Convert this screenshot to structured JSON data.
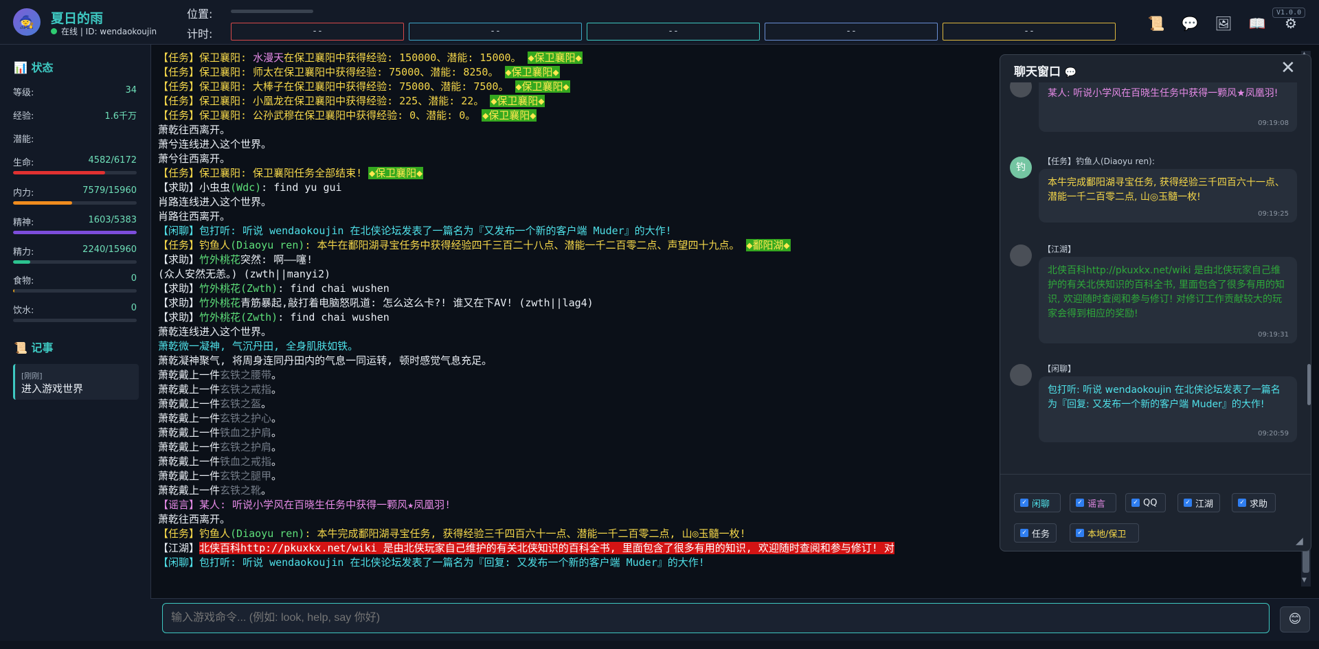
{
  "header": {
    "avatar_glyph": "🧙",
    "username": "夏日的雨",
    "status": "在线 | ID: wendaokoujin",
    "position_label": "位置:",
    "timer_label": "计时:",
    "timers": [
      "--",
      "--",
      "--",
      "--",
      "--"
    ],
    "timer_colors": [
      "#d94a4a",
      "#3ea7c9",
      "#3ec9c2",
      "#6a8fd6",
      "#e0b93e"
    ],
    "version": "V1.0.0",
    "icons": [
      {
        "name": "scroll-icon",
        "glyph": "📜"
      },
      {
        "name": "chat-bubble-icon",
        "glyph": "💬"
      },
      {
        "name": "image-icon",
        "glyph": "🖼"
      },
      {
        "name": "book-icon",
        "glyph": "📖"
      },
      {
        "name": "gear-icon",
        "glyph": "⚙"
      }
    ]
  },
  "sidebar": {
    "status_title": "状态",
    "stats": [
      {
        "label": "等级:",
        "value": "34"
      },
      {
        "label": "经验:",
        "value": "1.6千万"
      },
      {
        "label": "潜能:",
        "value": ""
      },
      {
        "label": "生命:",
        "value": "4582/6172",
        "ratio": 0.742,
        "color": "#e03131"
      },
      {
        "label": "内力:",
        "value": "7579/15960",
        "ratio": 0.475,
        "color": "#f08c1e"
      },
      {
        "label": "精神:",
        "value": "1603/5383",
        "ratio": 1.0,
        "color": "#7c4ddb"
      },
      {
        "label": "精力:",
        "value": "2240/15960",
        "ratio": 0.14,
        "color": "#2cc28f"
      },
      {
        "label": "食物:",
        "value": "0",
        "ratio": 0.01,
        "color": "#d1961e"
      },
      {
        "label": "饮水:",
        "value": "0",
        "ratio": 0,
        "color": "#2f7ef0"
      }
    ],
    "notes_title": "记事",
    "note": {
      "time": "[刚刚]",
      "text": "进入游戏世界"
    }
  },
  "log": [
    [
      {
        "t": "【任务】保卫襄阳: ",
        "c": "y"
      },
      {
        "t": "水漫天",
        "c": "p"
      },
      {
        "t": "在保卫襄阳中获得经验: 150000、潜能: 15000。 ",
        "c": "y"
      },
      {
        "t": "◆保卫襄阳◆",
        "c": "tag"
      }
    ],
    [
      {
        "t": "【任务】保卫襄阳: 师太在保卫襄阳中获得经验: 75000、潜能: 8250。 ",
        "c": "y"
      },
      {
        "t": "◆保卫襄阳◆",
        "c": "tag"
      }
    ],
    [
      {
        "t": "【任务】保卫襄阳: 大棒子在保卫襄阳中获得经验: 75000、潜能: 7500。 ",
        "c": "y"
      },
      {
        "t": "◆保卫襄阳◆",
        "c": "tag"
      }
    ],
    [
      {
        "t": "【任务】保卫襄阳: 小凰龙在保卫襄阳中获得经验: 225、潜能: 22。 ",
        "c": "y"
      },
      {
        "t": "◆保卫襄阳◆",
        "c": "tag"
      }
    ],
    [
      {
        "t": "【任务】保卫襄阳: 公孙武穆在保卫襄阳中获得经验: 0、潜能: 0。 ",
        "c": "y"
      },
      {
        "t": "◆保卫襄阳◆",
        "c": "tag"
      }
    ],
    [
      {
        "t": "萧乾往西离开。",
        "c": "w"
      }
    ],
    [
      {
        "t": "萧兮连线进入这个世界。",
        "c": "w"
      }
    ],
    [
      {
        "t": "萧兮往西离开。",
        "c": "w"
      }
    ],
    [
      {
        "t": "【任务】保卫襄阳: 保卫襄阳任务全部结束! ",
        "c": "y"
      },
      {
        "t": "◆保卫襄阳◆",
        "c": "tag"
      }
    ],
    [
      {
        "t": "【求助】小虫虫",
        "c": "w"
      },
      {
        "t": "(Wdc)",
        "c": "g"
      },
      {
        "t": ": find yu gui",
        "c": "w"
      }
    ],
    [
      {
        "t": "肖路连线进入这个世界。",
        "c": "w"
      }
    ],
    [
      {
        "t": "肖路往西离开。",
        "c": "w"
      }
    ],
    [
      {
        "t": "【闲聊】包打听: 听说 wendaokoujin 在北侠论坛发表了一篇名为『又发布一个新的客户端 Muder』的大作!",
        "c": "c"
      }
    ],
    [
      {
        "t": "【任务】钓鱼人",
        "c": "y"
      },
      {
        "t": "(Diaoyu ren)",
        "c": "g"
      },
      {
        "t": ": 本牛在鄱阳湖寻宝任务中获得经验四千三百二十八点、潜能一千二百零二点、声望四十九点。 ",
        "c": "y"
      },
      {
        "t": "◆鄱阳湖◆",
        "c": "tag"
      }
    ],
    [
      {
        "t": "【求助】",
        "c": "w"
      },
      {
        "t": "竹外桃花",
        "c": "g"
      },
      {
        "t": "突然: 啊——噻!",
        "c": "w"
      }
    ],
    [
      {
        "t": "(众人安然无恙。) (zwth||manyi2)",
        "c": "w"
      }
    ],
    [
      {
        "t": "【求助】",
        "c": "w"
      },
      {
        "t": "竹外桃花(Zwth)",
        "c": "g"
      },
      {
        "t": ": find chai wushen",
        "c": "w"
      }
    ],
    [
      {
        "t": "【求助】",
        "c": "w"
      },
      {
        "t": "竹外桃花",
        "c": "g"
      },
      {
        "t": "青筋暴起,敲打着电脑怒吼道: 怎么这么卡?! 谁又在下AV! (zwth||lag4)",
        "c": "w"
      }
    ],
    [
      {
        "t": "【求助】",
        "c": "w"
      },
      {
        "t": "竹外桃花(Zwth)",
        "c": "g"
      },
      {
        "t": ": find chai wushen",
        "c": "w"
      }
    ],
    [
      {
        "t": "萧乾连线进入这个世界。",
        "c": "w"
      }
    ],
    [
      {
        "t": "萧乾微一凝神, 气沉丹田, 全身肌肤如铁。",
        "c": "c"
      }
    ],
    [
      {
        "t": "萧乾凝神聚气, 将周身连同丹田内的气息一同运转, 顿时感觉气息充足。",
        "c": "w"
      }
    ],
    [
      {
        "t": "萧乾戴上一件",
        "c": "w"
      },
      {
        "t": "玄铁之腰带",
        "c": "gray"
      },
      {
        "t": "。",
        "c": "w"
      }
    ],
    [
      {
        "t": "萧乾戴上一件",
        "c": "w"
      },
      {
        "t": "玄铁之戒指",
        "c": "gray"
      },
      {
        "t": "。",
        "c": "w"
      }
    ],
    [
      {
        "t": "萧乾戴上一件",
        "c": "w"
      },
      {
        "t": "玄铁之盔",
        "c": "gray"
      },
      {
        "t": "。",
        "c": "w"
      }
    ],
    [
      {
        "t": "萧乾戴上一件",
        "c": "w"
      },
      {
        "t": "玄铁之护心",
        "c": "gray"
      },
      {
        "t": "。",
        "c": "w"
      }
    ],
    [
      {
        "t": "萧乾戴上一件",
        "c": "w"
      },
      {
        "t": "铁血之护肩",
        "c": "gray"
      },
      {
        "t": "。",
        "c": "w"
      }
    ],
    [
      {
        "t": "萧乾戴上一件",
        "c": "w"
      },
      {
        "t": "玄铁之护肩",
        "c": "gray"
      },
      {
        "t": "。",
        "c": "w"
      }
    ],
    [
      {
        "t": "萧乾戴上一件",
        "c": "w"
      },
      {
        "t": "铁血之戒指",
        "c": "gray"
      },
      {
        "t": "。",
        "c": "w"
      }
    ],
    [
      {
        "t": "萧乾戴上一件",
        "c": "w"
      },
      {
        "t": "玄铁之腿甲",
        "c": "gray"
      },
      {
        "t": "。",
        "c": "w"
      }
    ],
    [
      {
        "t": "萧乾戴上一件",
        "c": "w"
      },
      {
        "t": "玄铁之靴",
        "c": "gray"
      },
      {
        "t": "。",
        "c": "w"
      }
    ],
    [
      {
        "t": "【谣言】某人: 听说小学风在百晓生任务中获得一颗风★凤凰羽!",
        "c": "p"
      }
    ],
    [
      {
        "t": "萧乾往西离开。",
        "c": "w"
      }
    ],
    [
      {
        "t": "【任务】钓鱼人",
        "c": "y"
      },
      {
        "t": "(Diaoyu ren)",
        "c": "g"
      },
      {
        "t": ": 本牛完成鄱阳湖寻宝任务, 获得经验三千四百六十一点、潜能一千二百零二点, 山◎玉髓一枚!",
        "c": "y"
      }
    ],
    [
      {
        "t": "【江湖】",
        "c": "w"
      },
      {
        "t": "北侠百科http://pkuxkx.net/wiki 是由北侠玩家自己维护的有关北侠知识的百科全书, 里面包含了很多有用的知识, 欢迎随时查阅和参与修订! 对",
        "c": "redbg"
      }
    ],
    [
      {
        "t": "【闲聊】包打听: 听说 wendaokoujin 在北侠论坛发表了一篇名为『回复: 又发布一个新的客户端 Muder』的大作!",
        "c": "c"
      }
    ]
  ],
  "input": {
    "placeholder": "输入游戏命令... (例如: look, help, say 你好)",
    "emoji_glyph": "😊"
  },
  "chat": {
    "title": "聊天窗口",
    "title_glyph": "💬",
    "close_glyph": "✕",
    "messages": [
      {
        "sender": "",
        "text": "某人: 听说小学风在百晓生任务中获得一颗风★凤凰羽!",
        "time": "09:19:08",
        "color": "#e58ae6",
        "avatar": ""
      },
      {
        "sender": "【任务】钓鱼人(Diaoyu ren):",
        "text": "本牛完成鄱阳湖寻宝任务, 获得经验三千四百六十一点、潜能一千二百零二点, 山◎玉髓一枚!",
        "time": "09:19:25",
        "color": "#f5d74a",
        "avatar": "钓"
      },
      {
        "sender": "【江湖】",
        "text": "北侠百科http://pkuxkx.net/wiki 是由北侠玩家自己维护的有关北侠知识的百科全书, 里面包含了很多有用的知识, 欢迎随时查阅和参与修订! 对修订工作贡献较大的玩家会得到相应的奖励!",
        "time": "09:19:31",
        "color": "#2fa83a",
        "avatar": ""
      },
      {
        "sender": "【闲聊】",
        "text": "包打听: 听说 wendaokoujin 在北侠论坛发表了一篇名为『回复: 又发布一个新的客户端 Muder』的大作!",
        "time": "09:20:59",
        "color": "#4fe0e8",
        "avatar": ""
      }
    ],
    "filters": [
      {
        "label": "闲聊",
        "color": "#4fe0e8"
      },
      {
        "label": "谣言",
        "color": "#e58ae6"
      },
      {
        "label": "QQ",
        "color": "#e8edf3"
      },
      {
        "label": "江湖",
        "color": "#e8edf3"
      },
      {
        "label": "求助",
        "color": "#e8edf3"
      },
      {
        "label": "任务",
        "color": "#e8edf3"
      },
      {
        "label": "本地/保卫",
        "color": "#f5d74a"
      }
    ]
  }
}
